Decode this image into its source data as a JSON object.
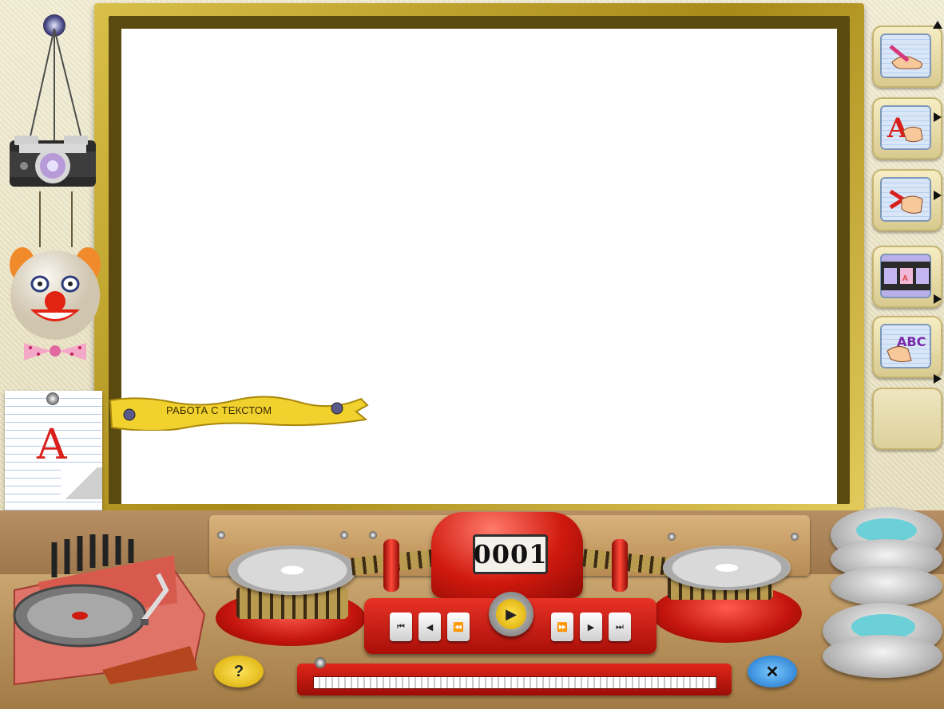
{
  "canvas": {
    "background": "#ffffff"
  },
  "banner": {
    "label": "РАБОТА С ТЕКСТОМ"
  },
  "tools": [
    {
      "name": "draw-tool",
      "icon": "hand-pencil-icon"
    },
    {
      "name": "text-tool",
      "icon": "hand-letter-a-icon"
    },
    {
      "name": "erase-tool",
      "icon": "hand-scissors-icon"
    },
    {
      "name": "film-tool",
      "icon": "film-strip-icon"
    },
    {
      "name": "abc-tool",
      "icon": "hand-abc-icon"
    },
    {
      "name": "empty-tool",
      "icon": ""
    }
  ],
  "counter": {
    "value": "0001"
  },
  "notepad": {
    "letter": "A"
  },
  "abc_icon_text": "ABC",
  "colors": {
    "frame": "#c8aa2c",
    "red": "#d0190e",
    "desk": "#b69064"
  }
}
